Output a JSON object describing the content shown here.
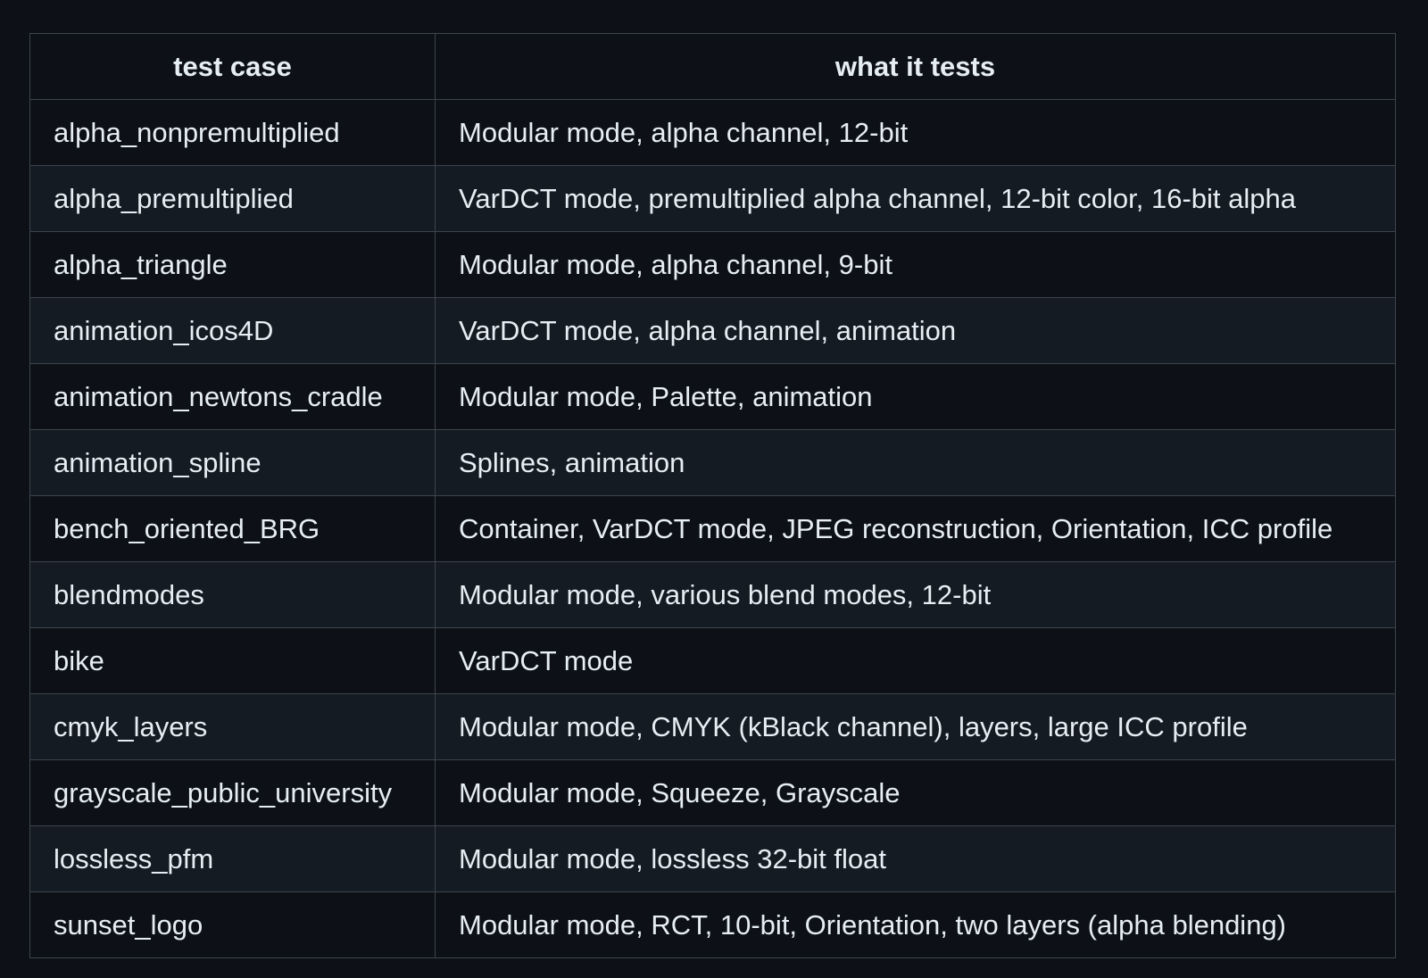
{
  "table": {
    "headers": [
      "test case",
      "what it tests"
    ],
    "rows": [
      [
        "alpha_nonpremultiplied",
        "Modular mode, alpha channel, 12-bit"
      ],
      [
        "alpha_premultiplied",
        "VarDCT mode, premultiplied alpha channel, 12-bit color, 16-bit alpha"
      ],
      [
        "alpha_triangle",
        "Modular mode, alpha channel, 9-bit"
      ],
      [
        "animation_icos4D",
        "VarDCT mode, alpha channel, animation"
      ],
      [
        "animation_newtons_cradle",
        "Modular mode, Palette, animation"
      ],
      [
        "animation_spline",
        "Splines, animation"
      ],
      [
        "bench_oriented_BRG",
        "Container, VarDCT mode, JPEG reconstruction, Orientation, ICC profile"
      ],
      [
        "blendmodes",
        "Modular mode, various blend modes, 12-bit"
      ],
      [
        "bike",
        "VarDCT mode"
      ],
      [
        "cmyk_layers",
        "Modular mode, CMYK (kBlack channel), layers, large ICC profile"
      ],
      [
        "grayscale_public_university",
        "Modular mode, Squeeze, Grayscale"
      ],
      [
        "lossless_pfm",
        "Modular mode, lossless 32-bit float"
      ],
      [
        "sunset_logo",
        "Modular mode, RCT, 10-bit, Orientation, two layers (alpha blending)"
      ]
    ]
  },
  "colors": {
    "background": "#0d1117",
    "row_alt": "#151b23",
    "border": "#3d444d",
    "text": "#e6edf3"
  }
}
